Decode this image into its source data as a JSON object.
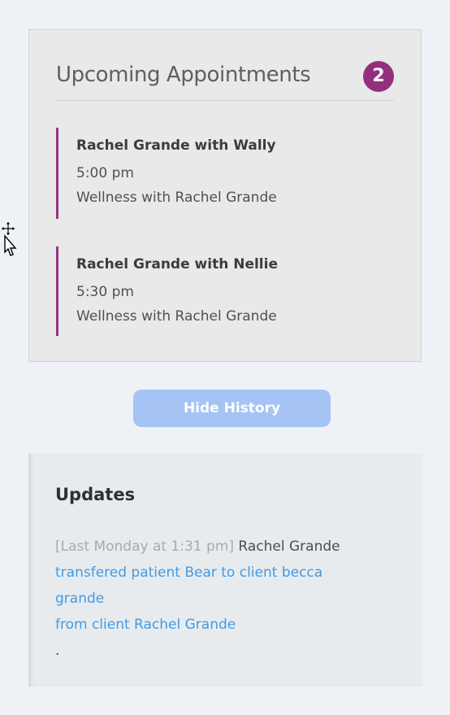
{
  "appointments": {
    "title": "Upcoming Appointments",
    "count": "2",
    "items": [
      {
        "title": "Rachel Grande with Wally",
        "time": "5:00 pm",
        "description": "Wellness with Rachel Grande"
      },
      {
        "title": "Rachel Grande with Nellie",
        "time": "5:30 pm",
        "description": "Wellness with Rachel Grande"
      }
    ]
  },
  "history_button": {
    "label": "Hide History"
  },
  "updates": {
    "title": "Updates",
    "entry": {
      "timestamp": "[Last Monday at 1:31 pm]",
      "user": "Rachel Grande",
      "action": "transfered patient Bear to client becca grande",
      "from": "from client Rachel Grande",
      "trailing": "."
    }
  },
  "colors": {
    "accent": "#93307e",
    "button": "#a5c3f3",
    "link": "#3f9be6"
  },
  "icons": {
    "cursor": "move-cursor-icon"
  }
}
